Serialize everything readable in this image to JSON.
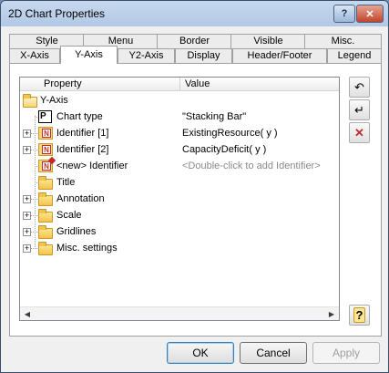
{
  "window": {
    "title": "2D Chart Properties",
    "help_glyph": "?",
    "close_glyph": "✕"
  },
  "tabs": {
    "back_row": [
      "Style",
      "Menu",
      "Border",
      "Visible",
      "Misc."
    ],
    "front_row": [
      "X-Axis",
      "Y-Axis",
      "Y2-Axis",
      "Display",
      "Header/Footer",
      "Legend"
    ],
    "active": "Y-Axis"
  },
  "grid": {
    "columns": [
      "Property",
      "Value"
    ],
    "rows": [
      {
        "label": "Y-Axis",
        "value": ""
      },
      {
        "label": "Chart type",
        "value": "\"Stacking Bar\"",
        "icon_text": "P"
      },
      {
        "label": "Identifier [1]",
        "value": "ExistingResource( y )",
        "icon_text": "N"
      },
      {
        "label": "Identifier [2]",
        "value": "CapacityDeficit( y )",
        "icon_text": "N"
      },
      {
        "label": "<new> Identifier",
        "value": "<Double-click to add Identifier>",
        "icon_text": "N"
      },
      {
        "label": "Title",
        "value": ""
      },
      {
        "label": "Annotation",
        "value": ""
      },
      {
        "label": "Scale",
        "value": ""
      },
      {
        "label": "Gridlines",
        "value": ""
      },
      {
        "label": "Misc. settings",
        "value": ""
      }
    ]
  },
  "side_buttons": {
    "undo": "↶",
    "redo": "↵",
    "delete": "✕",
    "help": "?"
  },
  "buttons": {
    "ok": "OK",
    "cancel": "Cancel",
    "apply": "Apply"
  }
}
